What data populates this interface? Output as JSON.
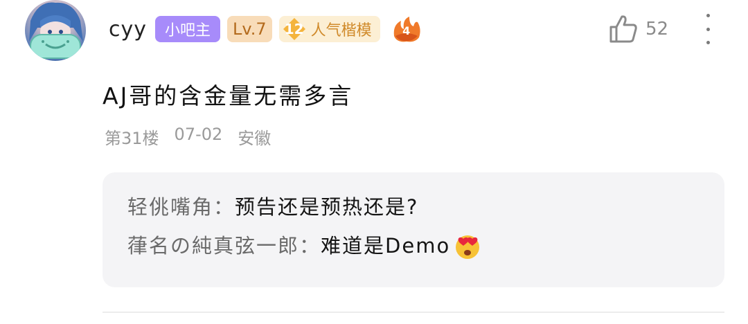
{
  "post": {
    "user": {
      "name": "cyy",
      "admin_badge": "小吧主",
      "level_badge": "Lv.7",
      "popularity_level": "12",
      "popularity_title": "人气楷模",
      "fire_badge_number": "4",
      "avatar_icon": "anime-avatar"
    },
    "like_count": "52",
    "comment_text": "AJ哥的含金量无需多言",
    "meta": {
      "floor": "第31楼",
      "date": "07-02",
      "location": "安徽"
    },
    "replies": [
      {
        "author": "轻佻嘴角：",
        "text": "预告还是预热还是?",
        "emoji": ""
      },
      {
        "author": "葎名の純真弦一郎：",
        "text": "难道是Demo",
        "emoji": "heart-eyes-emoji"
      }
    ]
  },
  "colors": {
    "admin_badge": "#a78bfa",
    "level_badge_bg": "#f8dcb9",
    "popularity_bg": "#fcefd4",
    "reply_bg": "#f4f4f6"
  }
}
